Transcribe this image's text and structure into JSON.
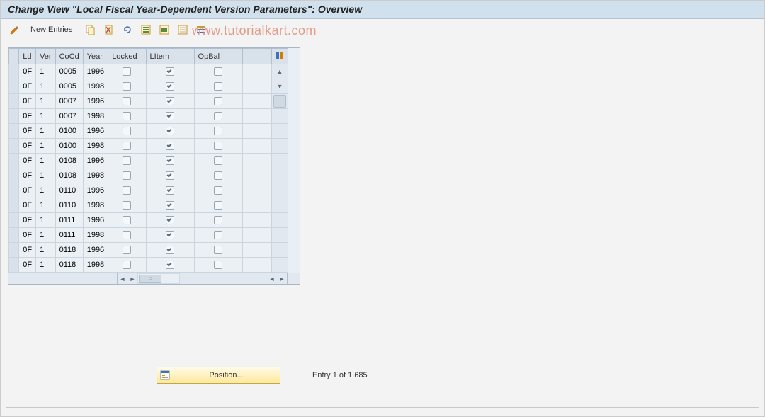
{
  "title": "Change View \"Local Fiscal Year-Dependent Version Parameters\": Overview",
  "watermark": "www.tutorialkart.com",
  "toolbar": {
    "new_entries": "New Entries"
  },
  "table": {
    "headers": {
      "ld": "Ld",
      "ver": "Ver",
      "cocd": "CoCd",
      "year": "Year",
      "locked": "Locked",
      "litem": "LItem",
      "opbal": "OpBal"
    },
    "rows": [
      {
        "ld": "0F",
        "ver": "1",
        "cocd": "0005",
        "year": "1996",
        "locked": false,
        "litem": true,
        "opbal": false
      },
      {
        "ld": "0F",
        "ver": "1",
        "cocd": "0005",
        "year": "1998",
        "locked": false,
        "litem": true,
        "opbal": false
      },
      {
        "ld": "0F",
        "ver": "1",
        "cocd": "0007",
        "year": "1996",
        "locked": false,
        "litem": true,
        "opbal": false
      },
      {
        "ld": "0F",
        "ver": "1",
        "cocd": "0007",
        "year": "1998",
        "locked": false,
        "litem": true,
        "opbal": false
      },
      {
        "ld": "0F",
        "ver": "1",
        "cocd": "0100",
        "year": "1996",
        "locked": false,
        "litem": true,
        "opbal": false
      },
      {
        "ld": "0F",
        "ver": "1",
        "cocd": "0100",
        "year": "1998",
        "locked": false,
        "litem": true,
        "opbal": false
      },
      {
        "ld": "0F",
        "ver": "1",
        "cocd": "0108",
        "year": "1996",
        "locked": false,
        "litem": true,
        "opbal": false
      },
      {
        "ld": "0F",
        "ver": "1",
        "cocd": "0108",
        "year": "1998",
        "locked": false,
        "litem": true,
        "opbal": false
      },
      {
        "ld": "0F",
        "ver": "1",
        "cocd": "0110",
        "year": "1996",
        "locked": false,
        "litem": true,
        "opbal": false
      },
      {
        "ld": "0F",
        "ver": "1",
        "cocd": "0110",
        "year": "1998",
        "locked": false,
        "litem": true,
        "opbal": false
      },
      {
        "ld": "0F",
        "ver": "1",
        "cocd": "0111",
        "year": "1996",
        "locked": false,
        "litem": true,
        "opbal": false
      },
      {
        "ld": "0F",
        "ver": "1",
        "cocd": "0111",
        "year": "1998",
        "locked": false,
        "litem": true,
        "opbal": false
      },
      {
        "ld": "0F",
        "ver": "1",
        "cocd": "0118",
        "year": "1996",
        "locked": false,
        "litem": true,
        "opbal": false
      },
      {
        "ld": "0F",
        "ver": "1",
        "cocd": "0118",
        "year": "1998",
        "locked": false,
        "litem": true,
        "opbal": false
      }
    ]
  },
  "footer": {
    "position_label": "Position...",
    "entry_status": "Entry 1 of 1.685"
  }
}
